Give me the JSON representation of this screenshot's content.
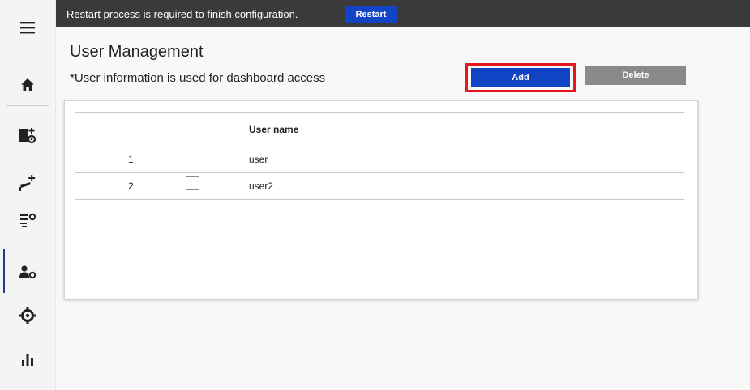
{
  "notification": {
    "message": "Restart process is required to finish configuration.",
    "restart_label": "Restart"
  },
  "sidebar": {
    "items": [
      {
        "icon": "menu-icon"
      },
      {
        "icon": "home-icon"
      },
      {
        "icon": "device-settings-icon"
      },
      {
        "icon": "add-camera-icon"
      },
      {
        "icon": "list-settings-icon"
      },
      {
        "icon": "user-settings-icon",
        "active": true
      },
      {
        "icon": "gear-icon"
      },
      {
        "icon": "bar-chart-icon"
      }
    ]
  },
  "page": {
    "title": "User Management",
    "subtitle": "*User information is used for dashboard access"
  },
  "actions": {
    "add_label": "Add",
    "delete_label": "Delete"
  },
  "table": {
    "header_user": "User name",
    "rows": [
      {
        "index": "1",
        "name": "user",
        "checked": false
      },
      {
        "index": "2",
        "name": "user2",
        "checked": false
      }
    ]
  },
  "colors": {
    "primary": "#1044c4",
    "highlight": "#e4161e",
    "disabled": "#8a8a8a",
    "topbar": "#3a3a3a"
  }
}
